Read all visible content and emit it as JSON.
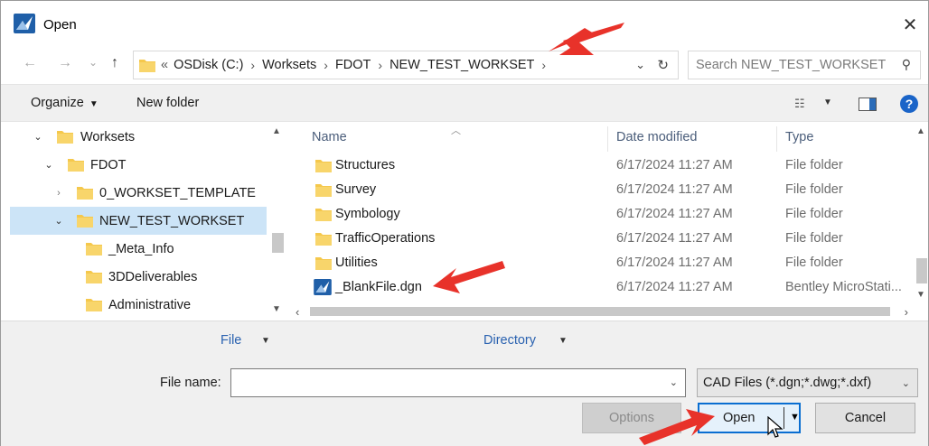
{
  "window": {
    "title": "Open",
    "close_glyph": "✕"
  },
  "nav": {
    "back_glyph": "←",
    "forward_glyph": "→",
    "recent_glyph": "⌄",
    "up_glyph": "↑"
  },
  "address": {
    "lead": "«",
    "crumbs": [
      "OSDisk (C:)",
      "Worksets",
      "FDOT",
      "NEW_TEST_WORKSET"
    ],
    "separator": "›",
    "dropdown_glyph": "⌄",
    "refresh_glyph": "↻"
  },
  "search": {
    "placeholder": "Search NEW_TEST_WORKSET",
    "icon_glyph": "⚲"
  },
  "toolbar": {
    "organize_label": "Organize",
    "new_folder_label": "New folder",
    "help_glyph": "?",
    "view_glyph": "☷"
  },
  "tree": {
    "items": [
      {
        "label": "Worksets",
        "chevron": "⌄"
      },
      {
        "label": "FDOT",
        "chevron": "⌄"
      },
      {
        "label": "0_WORKSET_TEMPLATE",
        "chevron": "›"
      },
      {
        "label": "NEW_TEST_WORKSET",
        "chevron": "⌄",
        "selected": true
      },
      {
        "label": "_Meta_Info",
        "chevron": ""
      },
      {
        "label": "3DDeliverables",
        "chevron": ""
      },
      {
        "label": "Administrative",
        "chevron": ""
      }
    ]
  },
  "filelist": {
    "columns": {
      "name": "Name",
      "date": "Date modified",
      "type": "Type"
    },
    "rows": [
      {
        "name": "Structures",
        "date": "6/17/2024 11:27 AM",
        "type": "File folder",
        "kind": "folder"
      },
      {
        "name": "Survey",
        "date": "6/17/2024 11:27 AM",
        "type": "File folder",
        "kind": "folder"
      },
      {
        "name": "Symbology",
        "date": "6/17/2024 11:27 AM",
        "type": "File folder",
        "kind": "folder"
      },
      {
        "name": "TrafficOperations",
        "date": "6/17/2024 11:27 AM",
        "type": "File folder",
        "kind": "folder"
      },
      {
        "name": "Utilities",
        "date": "6/17/2024 11:27 AM",
        "type": "File folder",
        "kind": "folder"
      },
      {
        "name": "_BlankFile.dgn",
        "date": "6/17/2024 11:27 AM",
        "type": "Bentley MicroStati...",
        "kind": "dgn"
      }
    ]
  },
  "split_controls": {
    "file_label": "File",
    "directory_label": "Directory"
  },
  "filename": {
    "label": "File name:",
    "value": ""
  },
  "filetype": {
    "selected": "CAD Files (*.dgn;*.dwg;*.dxf)"
  },
  "buttons": {
    "options_label": "Options",
    "open_label": "Open",
    "cancel_label": "Cancel"
  },
  "colors": {
    "accent": "#0a6ed1",
    "selection": "#cce4f7",
    "folder": "#f5c84c",
    "annotation_arrow": "#e8322a"
  }
}
